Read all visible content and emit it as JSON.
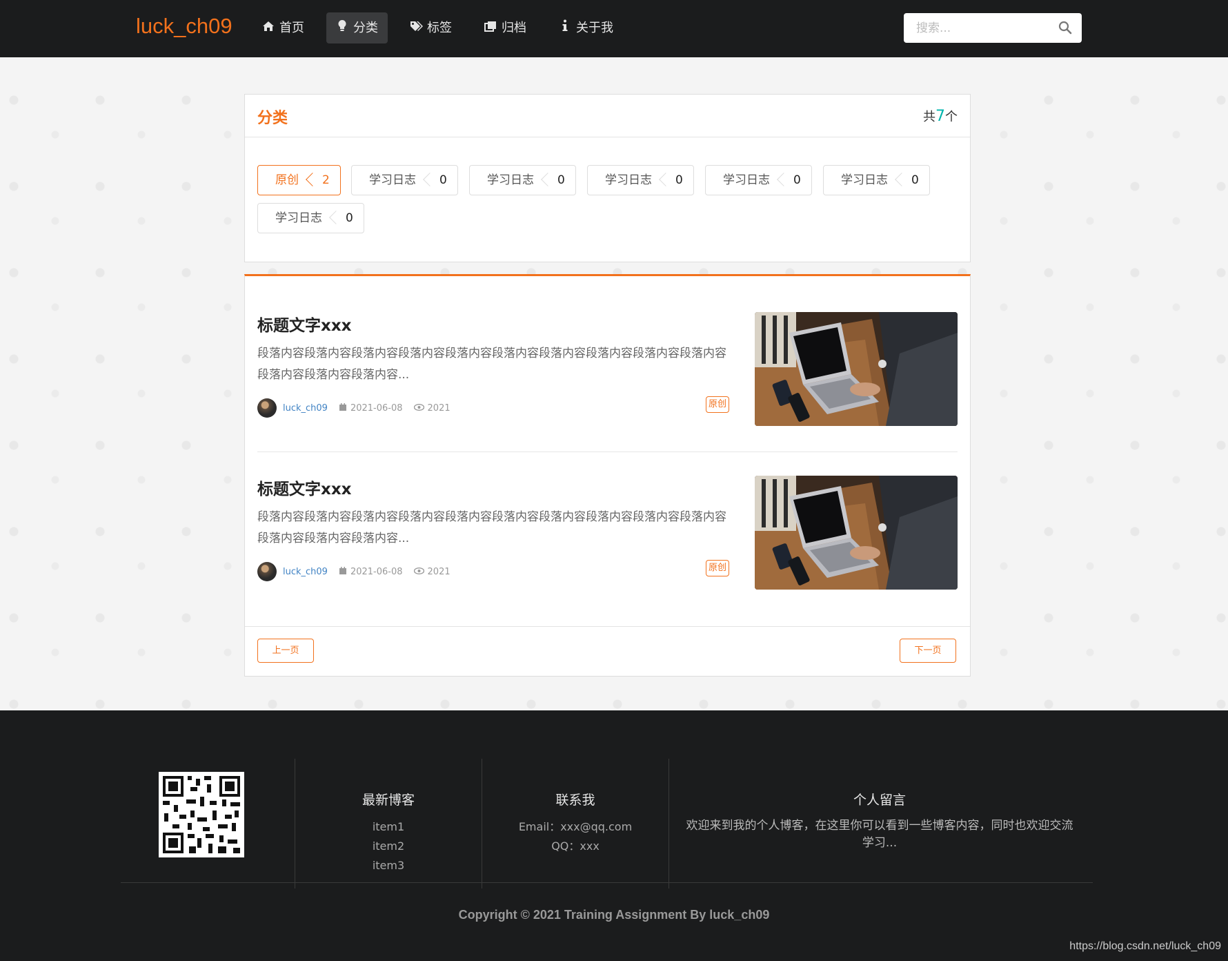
{
  "brand": "luck_ch09",
  "nav": [
    {
      "label": "首页",
      "icon": "home-icon"
    },
    {
      "label": "分类",
      "icon": "lightbulb-icon",
      "active": true
    },
    {
      "label": "标签",
      "icon": "tags-icon"
    },
    {
      "label": "归档",
      "icon": "clone-icon"
    },
    {
      "label": "关于我",
      "icon": "info-icon"
    }
  ],
  "search": {
    "placeholder": "搜索..."
  },
  "categories": {
    "title": "分类",
    "count_prefix": "共",
    "count": "7",
    "count_suffix": "个",
    "items": [
      {
        "label": "原创",
        "count": "2",
        "active": true
      },
      {
        "label": "学习日志",
        "count": "0"
      },
      {
        "label": "学习日志",
        "count": "0"
      },
      {
        "label": "学习日志",
        "count": "0"
      },
      {
        "label": "学习日志",
        "count": "0"
      },
      {
        "label": "学习日志",
        "count": "0"
      },
      {
        "label": "学习日志",
        "count": "0"
      }
    ]
  },
  "posts": [
    {
      "title": "标题文字xxx",
      "excerpt": "段落内容段落内容段落内容段落内容段落内容段落内容段落内容段落内容段落内容段落内容段落内容段落内容段落内容...",
      "author": "luck_ch09",
      "date": "2021-06-08",
      "views": "2021",
      "tag": "原创"
    },
    {
      "title": "标题文字xxx",
      "excerpt": "段落内容段落内容段落内容段落内容段落内容段落内容段落内容段落内容段落内容段落内容段落内容段落内容段落内容...",
      "author": "luck_ch09",
      "date": "2021-06-08",
      "views": "2021",
      "tag": "原创"
    }
  ],
  "pager": {
    "prev": "上一页",
    "next": "下一页"
  },
  "footer": {
    "latest": {
      "title": "最新博客",
      "items": [
        "item1",
        "item2",
        "item3"
      ]
    },
    "contact": {
      "title": "联系我",
      "email": "Email：xxx@qq.com",
      "qq": "QQ：xxx"
    },
    "message": {
      "title": "个人留言",
      "text": "欢迎来到我的个人博客，在这里你可以看到一些博客内容，同时也欢迎交流学习..."
    },
    "copyright": "Copyright © 2021 Training Assignment By luck_ch09"
  },
  "watermark": "https://blog.csdn.net/luck_ch09",
  "colors": {
    "accent": "#f2711c",
    "teal": "#00b5ad",
    "dark": "#1b1c1d",
    "link": "#4183c4"
  }
}
